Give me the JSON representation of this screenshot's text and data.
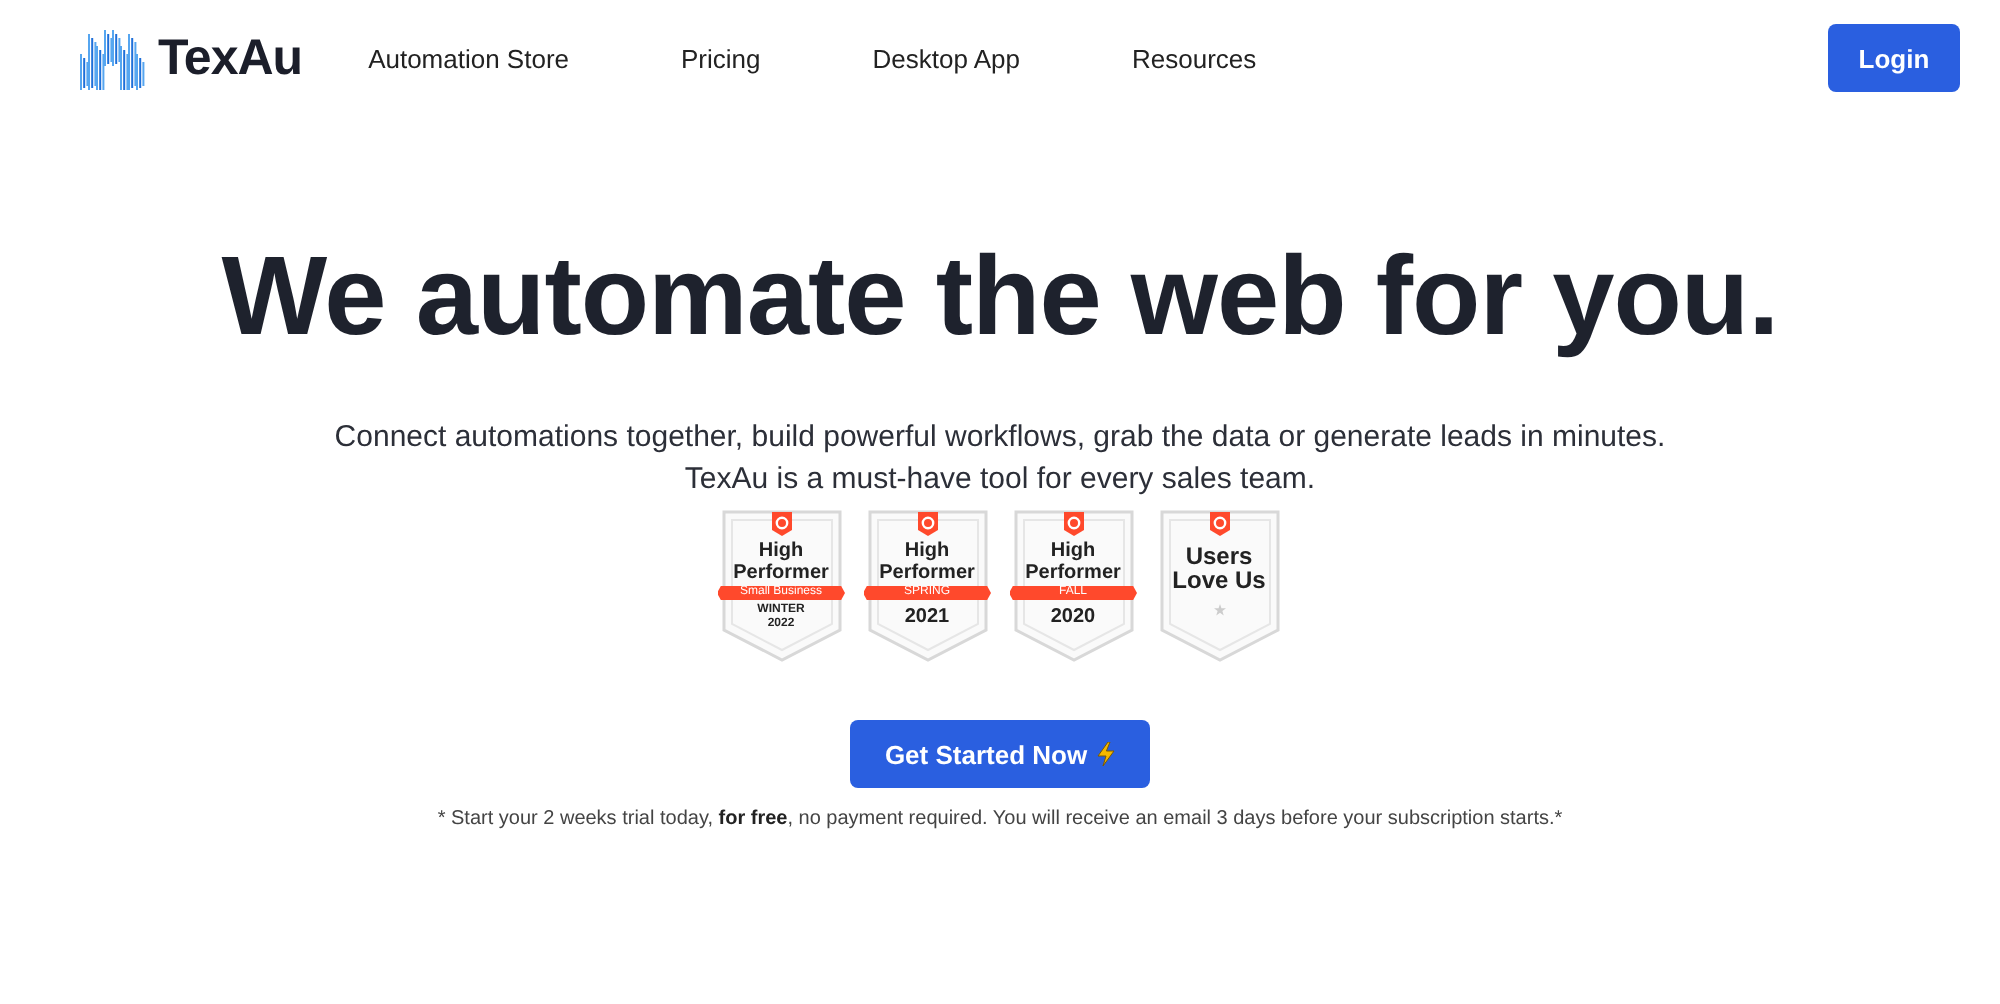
{
  "header": {
    "logo_text": "TexAu",
    "nav": [
      {
        "label": "Automation Store"
      },
      {
        "label": "Pricing"
      },
      {
        "label": "Desktop App"
      },
      {
        "label": "Resources"
      }
    ],
    "login": "Login"
  },
  "hero": {
    "headline": "We automate the web for you.",
    "subtitle_lines": [
      "Connect automations together, build powerful workflows, grab the data or generate leads in minutes.",
      "TexAu is a must-have tool for every sales team."
    ]
  },
  "badges": [
    {
      "kind": "ribbon",
      "title": "High Performer",
      "ribbon": "Small Business",
      "footer": [
        "WINTER",
        "2022"
      ]
    },
    {
      "kind": "ribbon",
      "title": "High Performer",
      "ribbon": "SPRING",
      "footer": [
        "2021"
      ]
    },
    {
      "kind": "ribbon",
      "title": "High Performer",
      "ribbon": "FALL",
      "footer": [
        "2020"
      ]
    },
    {
      "kind": "plain",
      "title": "Users Love Us"
    }
  ],
  "cta": {
    "label": "Get Started Now"
  },
  "footnote": "* Start your 2 weeks trial today, **for free**, no payment required. You will receive an email 3 days before your subscription starts.*"
}
